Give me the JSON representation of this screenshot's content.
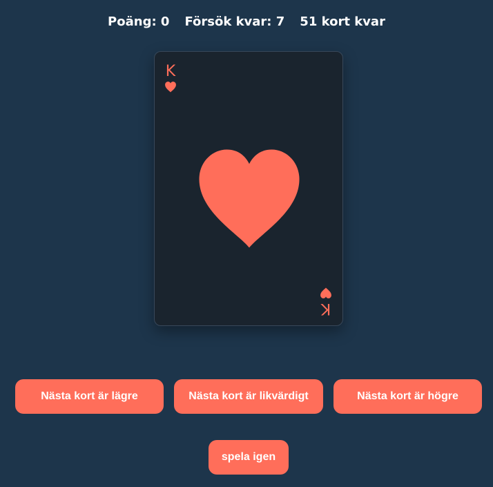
{
  "stats": {
    "score": "Poäng: 0",
    "attempts": "Försök kvar: 7",
    "cards_left": "51 kort kvar"
  },
  "card": {
    "rank": "K",
    "suit": "heart-icon",
    "color": "#ff6e5a"
  },
  "actions": {
    "lower": "Nästa kort är lägre",
    "equal": "Nästa kort är likvärdigt",
    "higher": "Nästa kort är högre",
    "replay": "spela igen"
  },
  "colors": {
    "background": "#1d354b",
    "card_face": "#1a242e",
    "accent": "#ff6e5a",
    "text": "#ffffff"
  }
}
